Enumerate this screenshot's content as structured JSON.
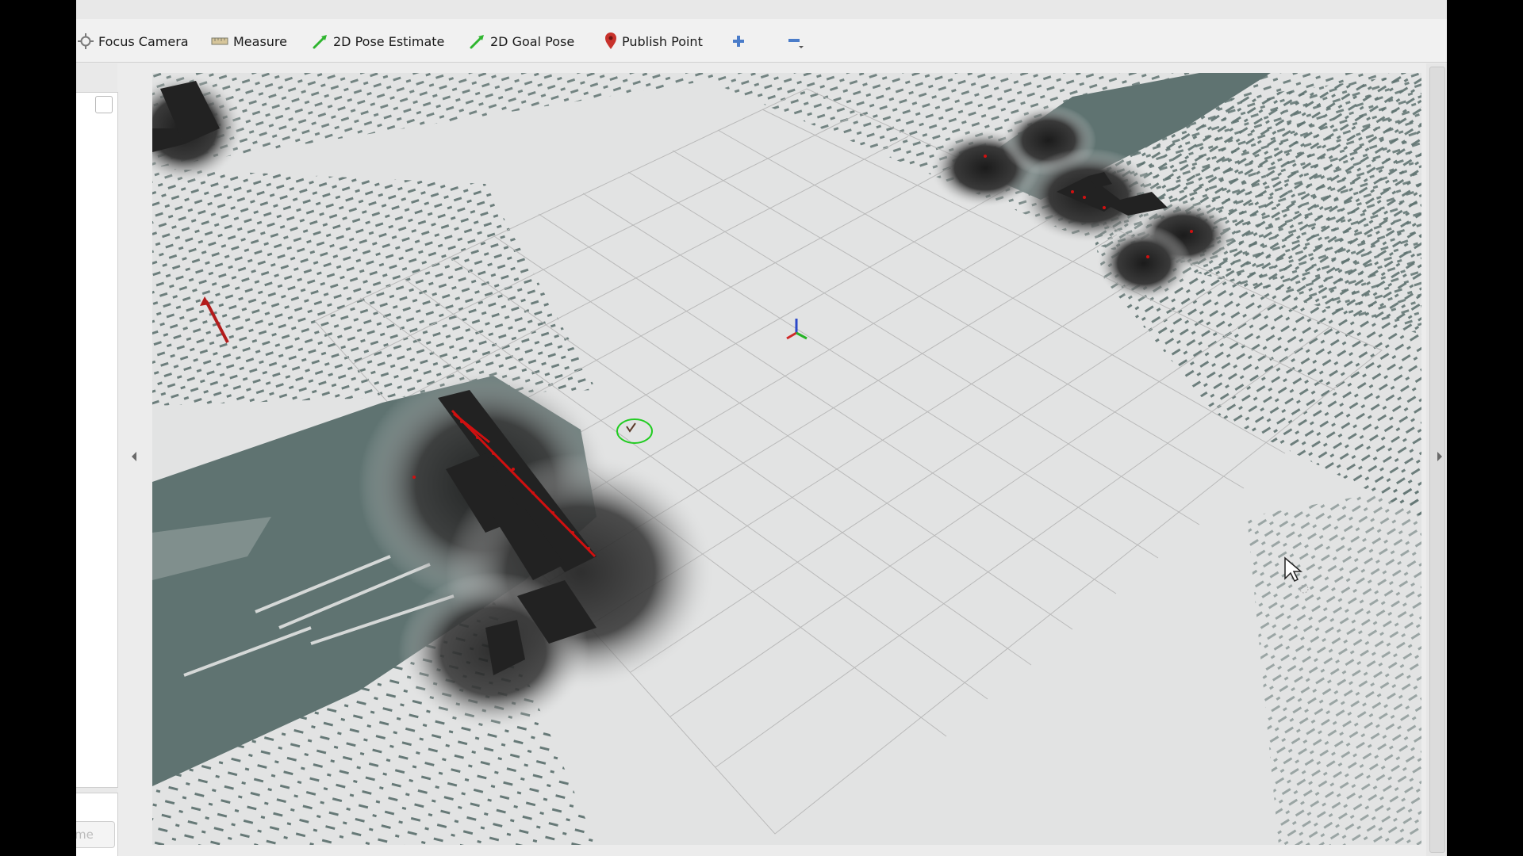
{
  "toolbar": {
    "tools": [
      {
        "label": "Focus Camera",
        "icon": "focus-camera-icon"
      },
      {
        "label": "Measure",
        "icon": "measure-ruler-icon"
      },
      {
        "label": "2D Pose Estimate",
        "icon": "green-arrow-icon"
      },
      {
        "label": "2D Goal Pose",
        "icon": "green-arrow-icon"
      },
      {
        "label": "Publish Point",
        "icon": "map-pin-icon"
      }
    ],
    "add_icon": "plus-icon",
    "remove_icon": "minus-icon"
  },
  "left_panel": {
    "button_label": "me"
  },
  "viewport": {
    "background_color": "#e2e3e3",
    "scan_color": "#5f7371",
    "obstacle_color": "#222222",
    "laser_color": "#d01010",
    "goal_color": "#22cc22"
  }
}
